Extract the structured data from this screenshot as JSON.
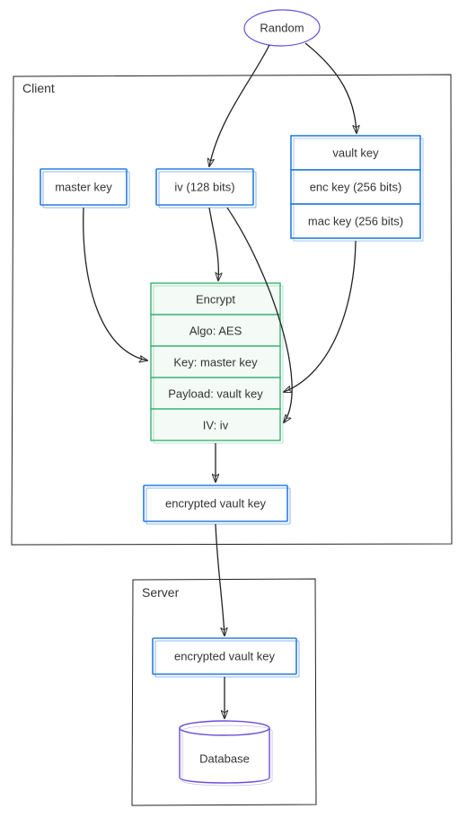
{
  "nodes": {
    "random": "Random",
    "client": "Client",
    "server": "Server",
    "master_key": "master key",
    "iv": "iv (128 bits)",
    "vault_key_header": "vault key",
    "enc_key": "enc key (256 bits)",
    "mac_key": "mac key (256 bits)",
    "encrypt": "Encrypt",
    "algo": "Algo: AES",
    "key_row": "Key: master key",
    "payload_row": "Payload: vault key",
    "iv_row": "IV: iv",
    "encrypted_vault_key": "encrypted vault key",
    "server_encrypted_vault_key": "encrypted vault key",
    "database": "Database"
  }
}
